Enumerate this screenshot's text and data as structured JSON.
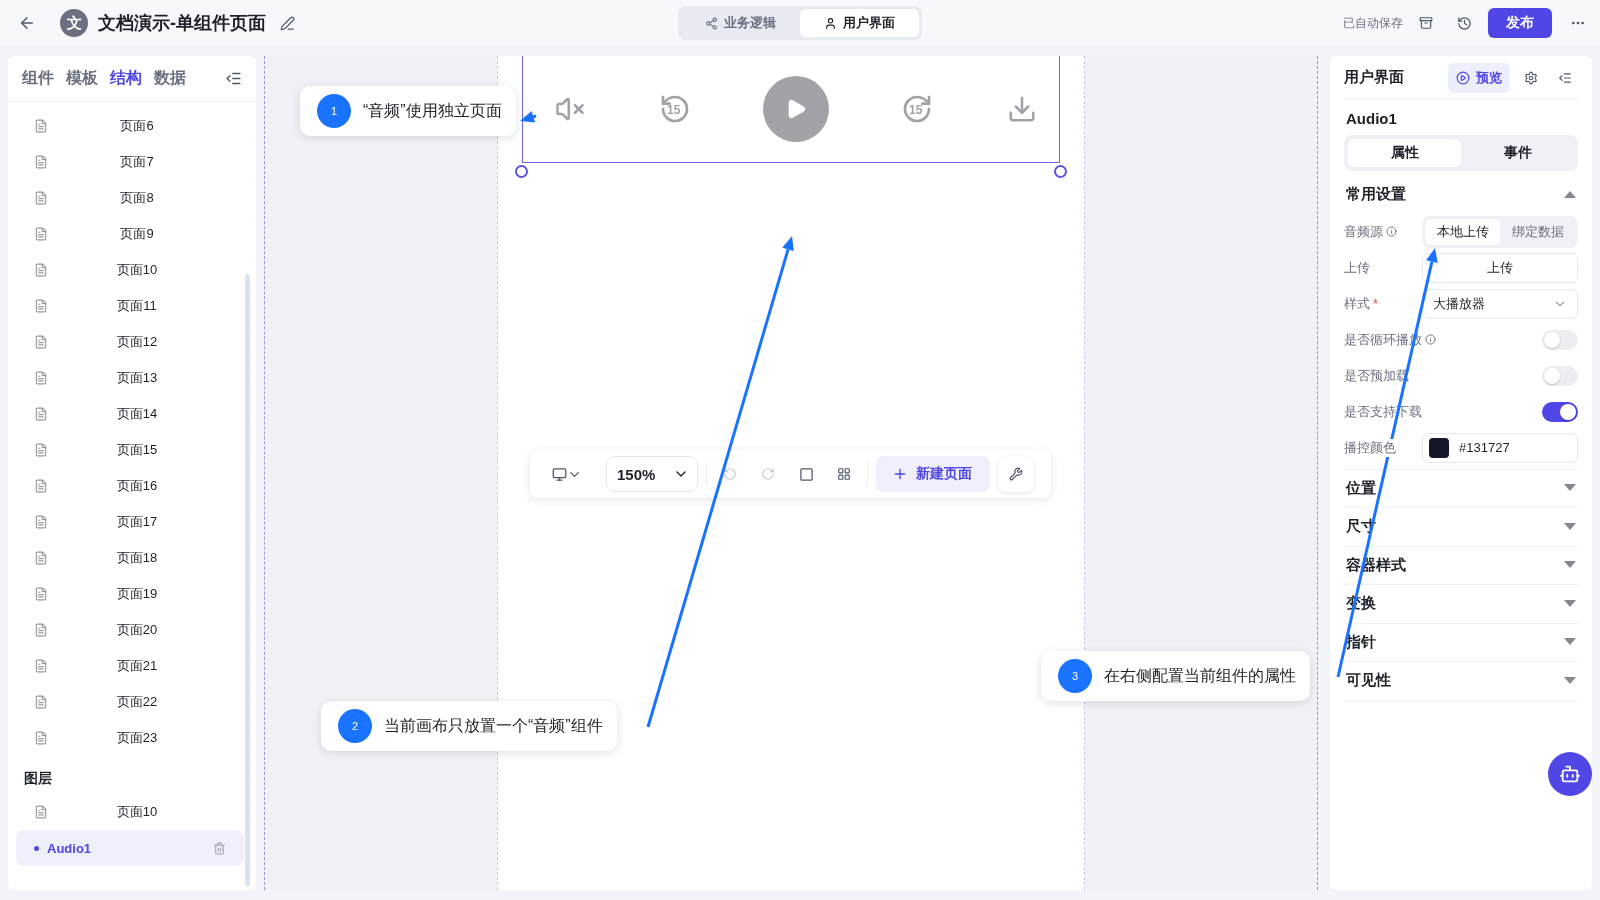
{
  "header": {
    "app_icon": "文",
    "title": "文档演示-单组件页面",
    "tabs": [
      {
        "label": "业务逻辑",
        "kind": "logic",
        "selected": false
      },
      {
        "label": "用户界面",
        "kind": "ui",
        "selected": true
      }
    ],
    "autosave": "已自动保存",
    "publish": "发布"
  },
  "left_panel": {
    "tabs": [
      {
        "label": "组件",
        "selected": false
      },
      {
        "label": "模板",
        "selected": false
      },
      {
        "label": "结构",
        "selected": true
      },
      {
        "label": "数据",
        "selected": false
      }
    ],
    "pages": [
      "页面6",
      "页面7",
      "页面8",
      "页面9",
      "页面10",
      "页面11",
      "页面12",
      "页面13",
      "页面14",
      "页面15",
      "页面16",
      "页面17",
      "页面18",
      "页面19",
      "页面20",
      "页面21",
      "页面22",
      "页面23"
    ],
    "layers_title": "图层",
    "layers": [
      {
        "label": "页面10",
        "kind": "page",
        "selected": false
      },
      {
        "label": "Audio1",
        "kind": "component",
        "selected": true
      }
    ]
  },
  "canvas": {
    "player": {
      "skip_back": "15",
      "skip_forward": "15",
      "muted": true
    },
    "toolbar": {
      "zoom": "150%",
      "new_page": "新建页面"
    }
  },
  "right_panel": {
    "title": "用户界面",
    "preview": "预览",
    "component_name": "Audio1",
    "tabs": [
      {
        "label": "属性",
        "selected": true
      },
      {
        "label": "事件",
        "selected": false
      }
    ],
    "common": {
      "title": "常用设置",
      "expanded": true,
      "fields": [
        {
          "kind": "segment",
          "label": "音频源",
          "info": true,
          "options": [
            {
              "label": "本地上传",
              "selected": true
            },
            {
              "label": "绑定数据",
              "selected": false
            }
          ]
        },
        {
          "kind": "button",
          "label": "上传",
          "value": "上传"
        },
        {
          "kind": "select",
          "label": "样式",
          "required_mark": "*",
          "value": "大播放器"
        },
        {
          "kind": "switch",
          "label": "是否循环播放",
          "info": true,
          "on": false
        },
        {
          "kind": "switch",
          "label": "是否预加载",
          "on": false
        },
        {
          "kind": "switch",
          "label": "是否支持下载",
          "on": true
        },
        {
          "kind": "color",
          "label": "播控颜色",
          "value": "#131727"
        }
      ]
    },
    "sections": [
      {
        "title": "位置",
        "expanded": false
      },
      {
        "title": "尺寸",
        "expanded": false
      },
      {
        "title": "容器样式",
        "expanded": false
      },
      {
        "title": "变换",
        "expanded": false
      },
      {
        "title": "指针",
        "expanded": false
      },
      {
        "title": "可见性",
        "expanded": false
      }
    ]
  },
  "annotations": [
    {
      "number": "1",
      "text": "“音频”使用独立页面"
    },
    {
      "number": "2",
      "text": "当前画布只放置一个“音频”组件"
    },
    {
      "number": "3",
      "text": "在右侧配置当前组件的属性"
    }
  ]
}
